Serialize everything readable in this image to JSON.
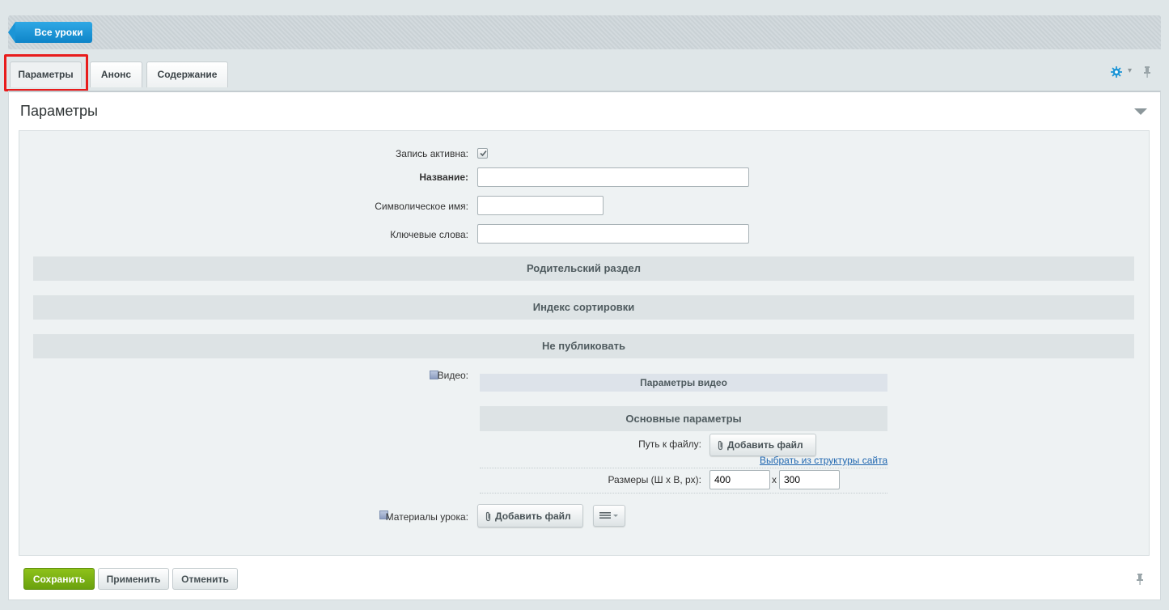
{
  "header": {
    "back_label": "Все уроки"
  },
  "tabs": [
    {
      "label": "Параметры",
      "active": true
    },
    {
      "label": "Анонс",
      "active": false
    },
    {
      "label": "Содержание",
      "active": false
    }
  ],
  "panel": {
    "title": "Параметры"
  },
  "form": {
    "active_label": "Запись активна:",
    "active_checked": true,
    "name_label": "Название:",
    "name_value": "",
    "code_label": "Символическое имя:",
    "code_value": "",
    "keywords_label": "Ключевые слова:",
    "keywords_value": ""
  },
  "sections": {
    "parent": "Родительский раздел",
    "sort": "Индекс сортировки",
    "unpublish": "Не публиковать"
  },
  "video": {
    "label": "Видео:",
    "params_header": "Параметры видео",
    "main_params_header": "Основные параметры",
    "path_label": "Путь к файлу:",
    "add_file_label": "Добавить файл",
    "choose_link": "Выбрать из структуры сайта",
    "size_label": "Размеры (Ш х В, px):",
    "width": "400",
    "size_sep": "x",
    "height": "300"
  },
  "materials": {
    "label": "Материалы урока:",
    "add_file_label": "Добавить файл"
  },
  "footer": {
    "save_label": "Сохранить",
    "apply_label": "Применить",
    "cancel_label": "Отменить"
  },
  "colors": {
    "accent_blue": "#1c95d6",
    "save_green": "#7ab316",
    "highlight_red": "#e81c1c"
  },
  "icons": {
    "settings": "gear-icon",
    "pin": "pin-icon",
    "collapse": "triangle-down-icon",
    "attach": "paperclip-icon",
    "menu": "hamburger-icon"
  }
}
